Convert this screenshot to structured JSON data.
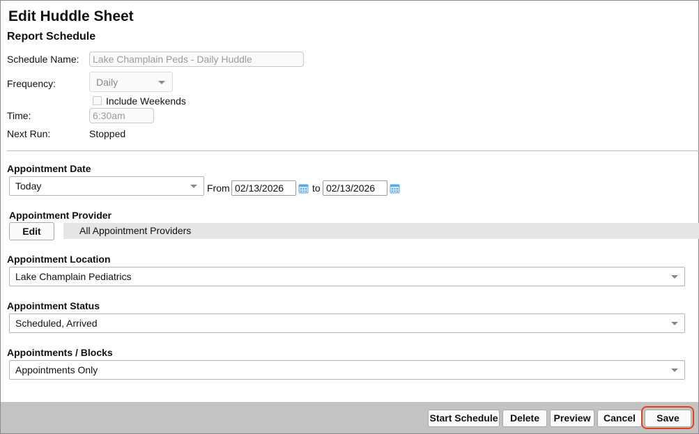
{
  "page": {
    "title": "Edit Huddle Sheet",
    "subtitle": "Report Schedule"
  },
  "schedule": {
    "name_label": "Schedule Name:",
    "name_value": "Lake Champlain Peds - Daily Huddle",
    "frequency_label": "Frequency:",
    "frequency_value": "Daily",
    "include_weekends_label": "Include Weekends",
    "include_weekends_checked": false,
    "time_label": "Time:",
    "time_value": "6:30am",
    "next_run_label": "Next Run:",
    "next_run_value": "Stopped"
  },
  "appointment_date": {
    "label": "Appointment Date",
    "range_value": "Today",
    "from_label": "From",
    "from_value": "02/13/2026",
    "to_label": "to",
    "to_value": "02/13/2026",
    "calendar_icon": "calendar-icon"
  },
  "appointment_provider": {
    "label": "Appointment Provider",
    "edit_label": "Edit",
    "value": "All Appointment Providers"
  },
  "appointment_location": {
    "label": "Appointment Location",
    "value": "Lake Champlain Pediatrics"
  },
  "appointment_status": {
    "label": "Appointment Status",
    "value": "Scheduled, Arrived"
  },
  "appointments_blocks": {
    "label": "Appointments / Blocks",
    "value": "Appointments Only"
  },
  "footer": {
    "start_schedule_label": "Start Schedule",
    "delete_label": "Delete",
    "preview_label": "Preview",
    "cancel_label": "Cancel",
    "save_label": "Save"
  },
  "colors": {
    "footer_bg": "#c3c3c3",
    "highlight_ring": "#e2401c",
    "calendar_icon": "#5aa9e6"
  }
}
